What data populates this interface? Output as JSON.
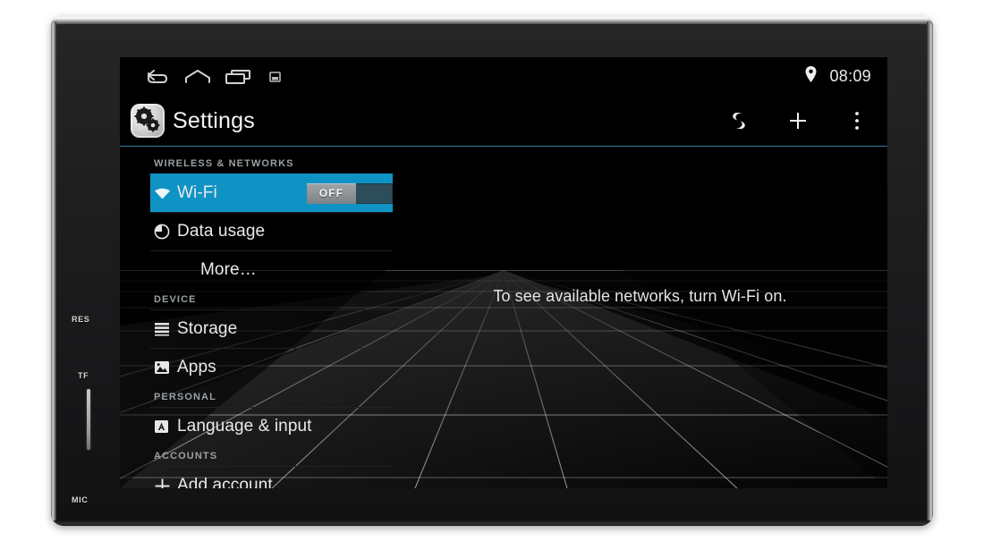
{
  "device": {
    "bezel_labels": [
      {
        "name": "reset",
        "text": "RES"
      },
      {
        "name": "tf-card",
        "text": "TF"
      },
      {
        "name": "microphone",
        "text": "MIC"
      }
    ],
    "knob": {
      "name": "volume-knob",
      "label": ""
    }
  },
  "status_bar": {
    "nav": [
      {
        "icon": "back-icon",
        "label": "Back"
      },
      {
        "icon": "home-icon",
        "label": "Home"
      },
      {
        "icon": "recents-icon",
        "label": "Recent apps"
      },
      {
        "icon": "screenshot-icon",
        "label": "Screenshot"
      }
    ],
    "location_icon": "location-pin-icon",
    "time": "08:09"
  },
  "action_bar": {
    "app_icon": "settings-gears-icon",
    "title": "Settings",
    "actions": [
      {
        "icon": "sync-icon",
        "label": "Scan"
      },
      {
        "icon": "plus-icon",
        "label": "Add network"
      },
      {
        "icon": "overflow-menu-icon",
        "label": "More options"
      }
    ]
  },
  "settings": {
    "groups": [
      {
        "header": "WIRELESS & NETWORKS",
        "items": [
          {
            "label": "Wi-Fi",
            "icon": "wifi-icon",
            "selected": true,
            "toggle": "OFF"
          },
          {
            "label": "Data usage",
            "icon": "data-usage-icon",
            "selected": false
          },
          {
            "label": "More…",
            "icon": "",
            "selected": false
          }
        ]
      },
      {
        "header": "DEVICE",
        "items": [
          {
            "label": "Storage",
            "icon": "storage-icon",
            "selected": false
          },
          {
            "label": "Apps",
            "icon": "apps-icon",
            "selected": false
          }
        ]
      },
      {
        "header": "PERSONAL",
        "items": [
          {
            "label": "Language & input",
            "icon": "language-input-icon",
            "selected": false
          }
        ]
      },
      {
        "header": "ACCOUNTS",
        "items": [
          {
            "label": "Add account",
            "icon": "plus-icon",
            "selected": false
          }
        ]
      }
    ]
  },
  "detail": {
    "empty_message": "To see available networks, turn Wi-Fi on."
  },
  "colors": {
    "accent_blue": "#0f93c4",
    "divider_blue": "#2f7d9c",
    "screen_black": "#000000",
    "text_primary": "#e8eaec",
    "text_secondary": "#9aa0a4"
  }
}
